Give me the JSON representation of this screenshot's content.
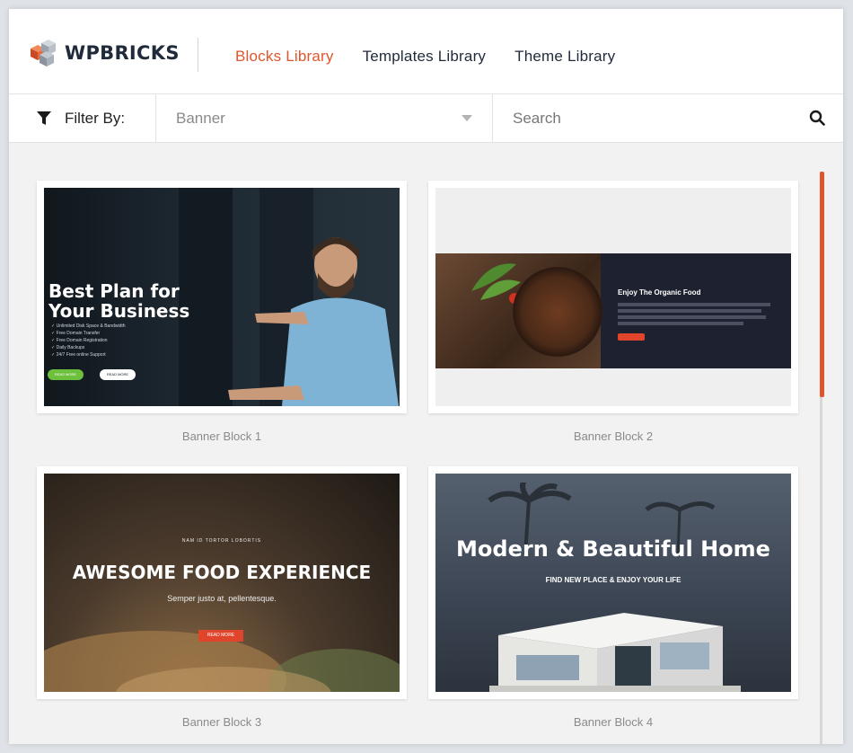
{
  "brand": {
    "name": "WPBRICKS"
  },
  "nav": {
    "items": [
      {
        "label": "Blocks Library",
        "active": true
      },
      {
        "label": "Templates Library",
        "active": false
      },
      {
        "label": "Theme Library",
        "active": false
      }
    ]
  },
  "filter": {
    "label": "Filter By:",
    "selected": "Banner"
  },
  "search": {
    "placeholder": "Search"
  },
  "colors": {
    "accent": "#e0562c",
    "text": "#1f2a3a"
  },
  "blocks": [
    {
      "label": "Banner Block 1",
      "preview": {
        "title_line1": "Best Plan for",
        "title_line2": "Your Business",
        "features": [
          "Unlimited Disk Space & Bandwidth",
          "Free Domain Transfer",
          "Free Domain Registration",
          "Daily Backups",
          "24/7 Free online Support"
        ],
        "btn1": "READ MORE",
        "btn2": "READ MORE"
      }
    },
    {
      "label": "Banner Block 2",
      "preview": {
        "title": "Enjoy The Organic Food"
      }
    },
    {
      "label": "Banner Block 3",
      "preview": {
        "eyebrow": "NAM ID TORTOR LOBORTIS",
        "title": "AWESOME FOOD EXPERIENCE",
        "subtitle": "Semper justo at, pellentesque.",
        "button": "READ MORE"
      }
    },
    {
      "label": "Banner Block 4",
      "preview": {
        "title": "Modern & Beautiful Home",
        "subtitle": "FIND NEW PLACE & ENJOY YOUR LIFE"
      }
    }
  ]
}
